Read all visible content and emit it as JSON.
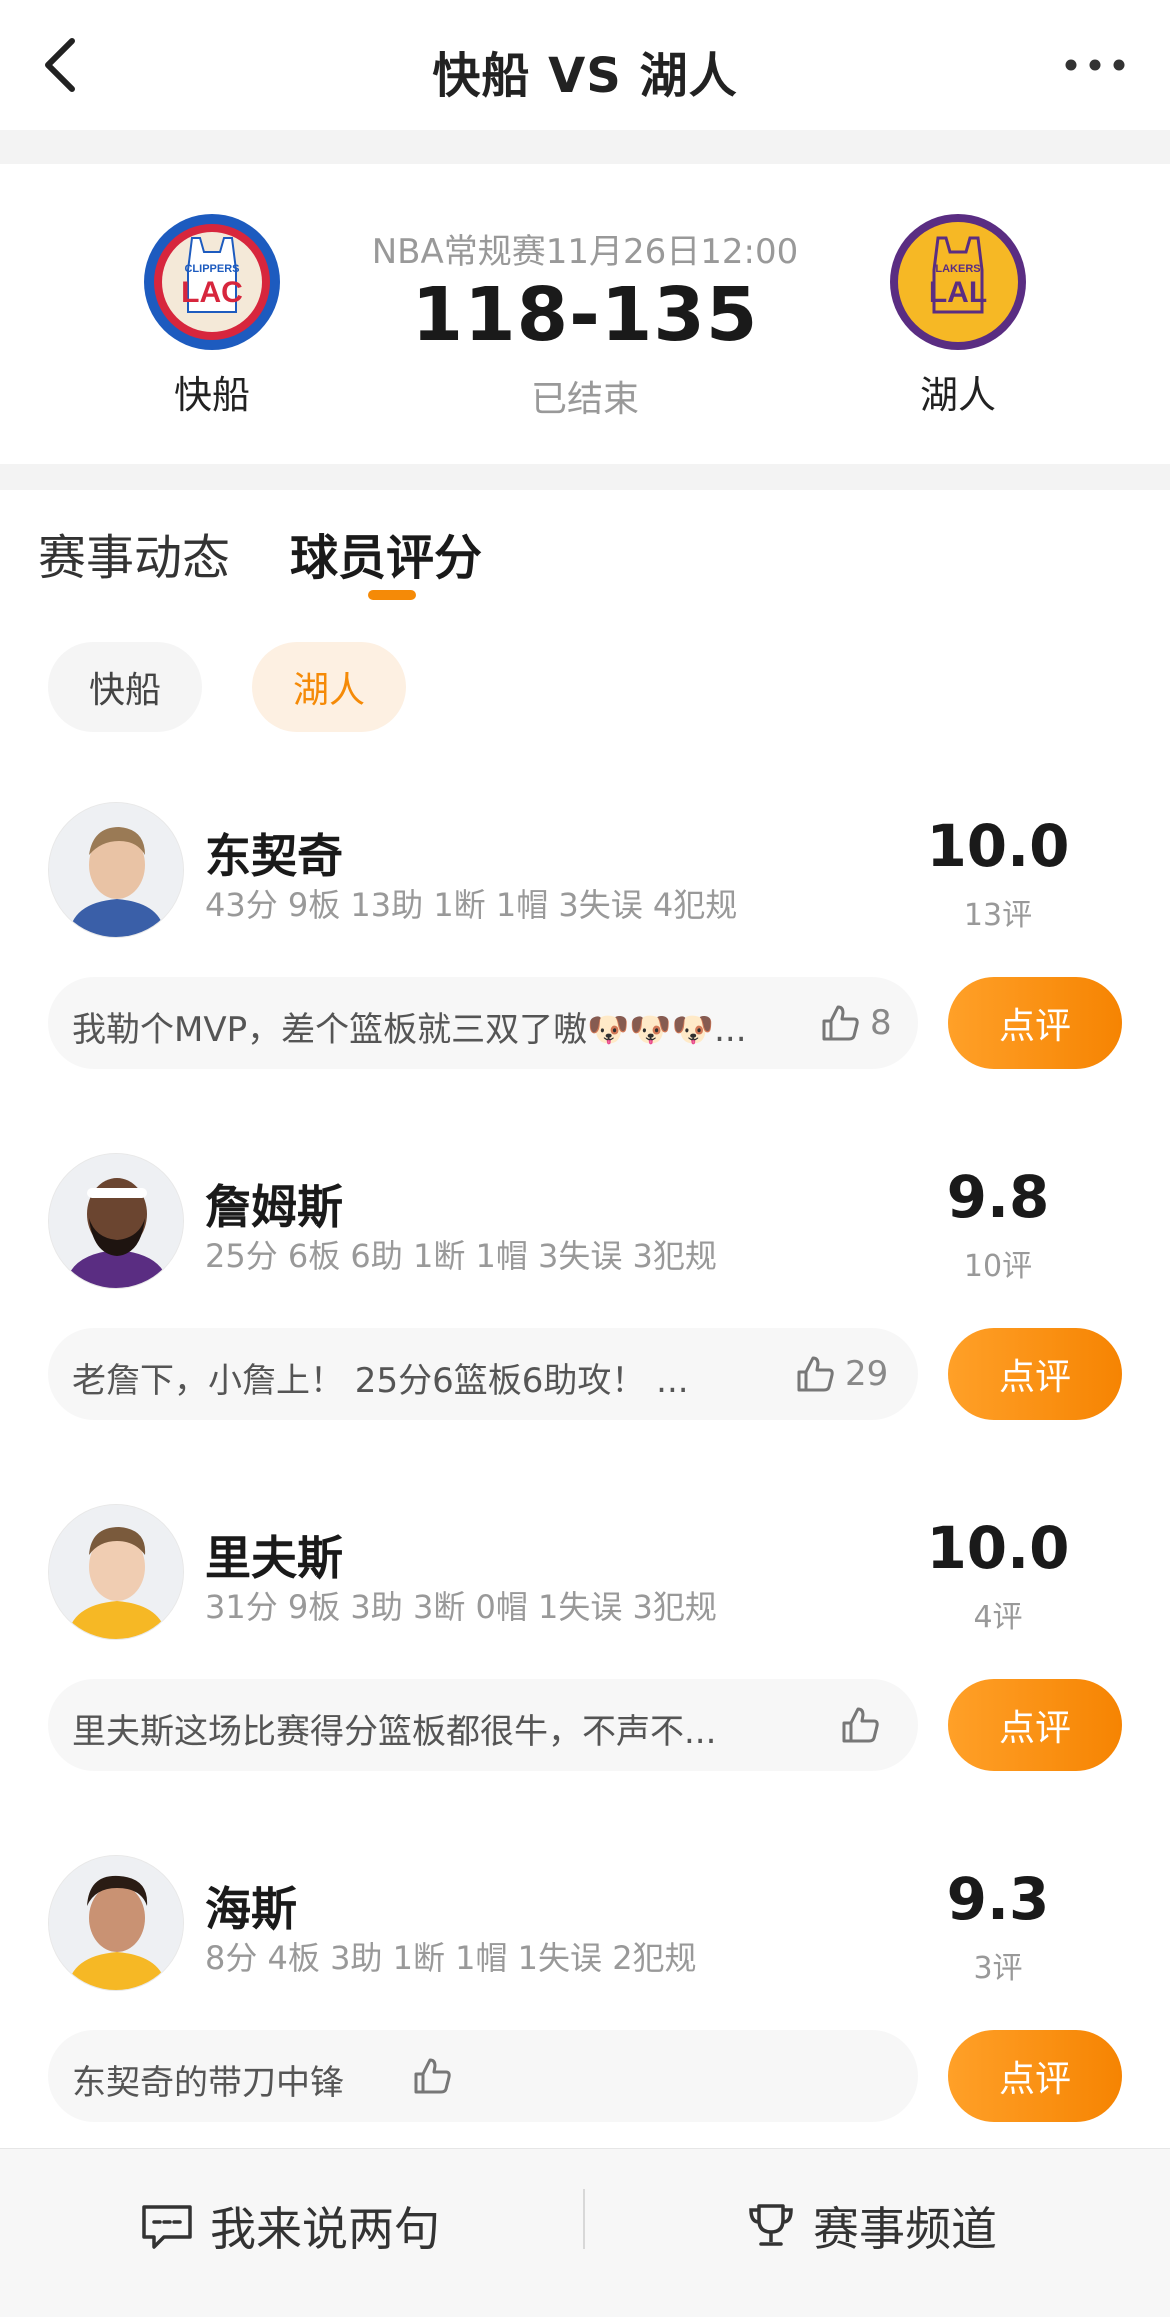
{
  "header": {
    "title": "快船 VS 湖人"
  },
  "match": {
    "home": {
      "name": "快船",
      "logo_top": "CLIPPERS",
      "logo_main": "LAC"
    },
    "away": {
      "name": "湖人",
      "logo_top": "LAKERS",
      "logo_main": "LAL"
    },
    "meta": "NBA常规赛11月26日12:00",
    "score": "118-135",
    "status": "已结束"
  },
  "tabs": [
    {
      "label": "赛事动态",
      "active": false
    },
    {
      "label": "球员评分",
      "active": true
    }
  ],
  "team_filter": [
    {
      "label": "快船",
      "active": false
    },
    {
      "label": "湖人",
      "active": true
    }
  ],
  "players": [
    {
      "name": "东契奇",
      "stats": "43分 9板 13助 1断 1帽 3失误 4犯规",
      "rating": "10.0",
      "rating_count": "13评",
      "comment": "我勒个MVP，差个篮板就三双了嗷🐶🐶🐶...",
      "likes": "8"
    },
    {
      "name": "詹姆斯",
      "stats": "25分 6板 6助 1断 1帽 3失误 3犯规",
      "rating": "9.8",
      "rating_count": "10评",
      "comment": "老詹下，小詹上！ 25分6篮板6助攻！ ...",
      "likes": "29"
    },
    {
      "name": "里夫斯",
      "stats": "31分 9板 3助 3断 0帽 1失误 3犯规",
      "rating": "10.0",
      "rating_count": "4评",
      "comment": "里夫斯这场比赛得分篮板都很牛，不声不...",
      "likes": ""
    },
    {
      "name": "海斯",
      "stats": "8分 4板 3助 1断 1帽 1失误 2犯规",
      "rating": "9.3",
      "rating_count": "3评",
      "comment": "东契奇的带刀中锋",
      "likes": ""
    }
  ],
  "review_button_label": "点评",
  "bottom_bar": {
    "comment_label": "我来说两句",
    "channel_label": "赛事频道"
  },
  "colors": {
    "accent": "#f58a07",
    "clippers_red": "#d7263d",
    "clippers_blue": "#1d5bbf",
    "lakers_purple": "#5a2d82",
    "lakers_gold": "#f6b825"
  }
}
